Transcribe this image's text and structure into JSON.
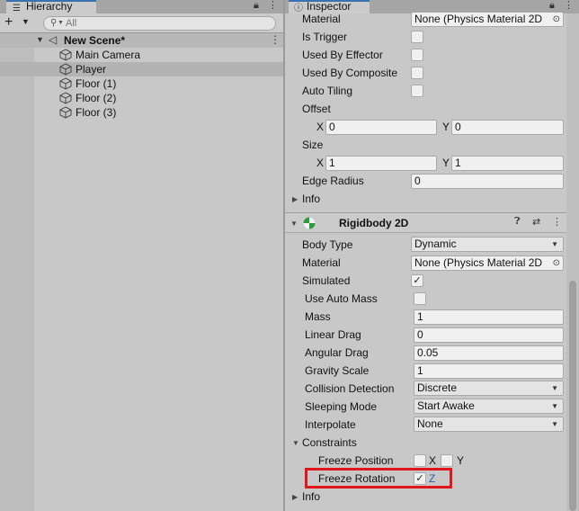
{
  "hierarchy": {
    "tab_label": "Hierarchy",
    "search_placeholder": "All",
    "scene_name": "New Scene*",
    "objects": [
      "Main Camera",
      "Player",
      "Floor (1)",
      "Floor (2)",
      "Floor (3)"
    ]
  },
  "inspector": {
    "tab_label": "Inspector",
    "collider": {
      "material_label": "Material",
      "material_value": "None (Physics Material 2D",
      "is_trigger_label": "Is Trigger",
      "used_by_effector_label": "Used By Effector",
      "used_by_composite_label": "Used By Composite",
      "auto_tiling_label": "Auto Tiling",
      "offset_label": "Offset",
      "offset_x": "0",
      "offset_y": "0",
      "size_label": "Size",
      "size_x": "1",
      "size_y": "1",
      "edge_radius_label": "Edge Radius",
      "edge_radius_value": "0",
      "info_label": "Info"
    },
    "axis": {
      "x": "X",
      "y": "Y",
      "z": "Z"
    },
    "rigidbody": {
      "title": "Rigidbody 2D",
      "body_type_label": "Body Type",
      "body_type_value": "Dynamic",
      "material_label": "Material",
      "material_value": "None (Physics Material 2D",
      "simulated_label": "Simulated",
      "use_auto_mass_label": "Use Auto Mass",
      "mass_label": "Mass",
      "mass_value": "1",
      "linear_drag_label": "Linear Drag",
      "linear_drag_value": "0",
      "angular_drag_label": "Angular Drag",
      "angular_drag_value": "0.05",
      "gravity_scale_label": "Gravity Scale",
      "gravity_scale_value": "1",
      "collision_detection_label": "Collision Detection",
      "collision_detection_value": "Discrete",
      "sleeping_mode_label": "Sleeping Mode",
      "sleeping_mode_value": "Start Awake",
      "interpolate_label": "Interpolate",
      "interpolate_value": "None",
      "constraints_label": "Constraints",
      "freeze_position_label": "Freeze Position",
      "freeze_rotation_label": "Freeze Rotation",
      "info_label": "Info"
    }
  },
  "colors": {
    "highlight": "#e0161c",
    "accent": "#3a72b0",
    "z_label": "#2b5aa0"
  }
}
